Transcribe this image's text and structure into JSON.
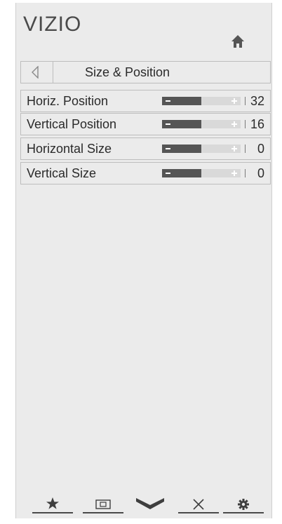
{
  "brand": {
    "logo": "VIZIO",
    "home_icon": "home-icon"
  },
  "header": {
    "title": "Size & Position",
    "back_icon": "back-arrow-icon"
  },
  "settings": [
    {
      "label": "Horiz. Position",
      "value": "32",
      "level": 0.5
    },
    {
      "label": "Vertical Position",
      "value": "16",
      "level": 0.5
    },
    {
      "label": "Horizontal Size",
      "value": "0",
      "level": 0.5
    },
    {
      "label": "Vertical Size",
      "value": "0",
      "level": 0.5
    }
  ],
  "bottom_nav": [
    {
      "icon": "star-icon"
    },
    {
      "icon": "picture-icon"
    },
    {
      "icon": "chevron-down-icon"
    },
    {
      "icon": "close-icon"
    },
    {
      "icon": "gear-icon"
    }
  ],
  "colors": {
    "panel": "#ebebeb",
    "slider_fill": "#555555",
    "slider_track": "#d9d9d9",
    "text": "#2a2a2a"
  }
}
